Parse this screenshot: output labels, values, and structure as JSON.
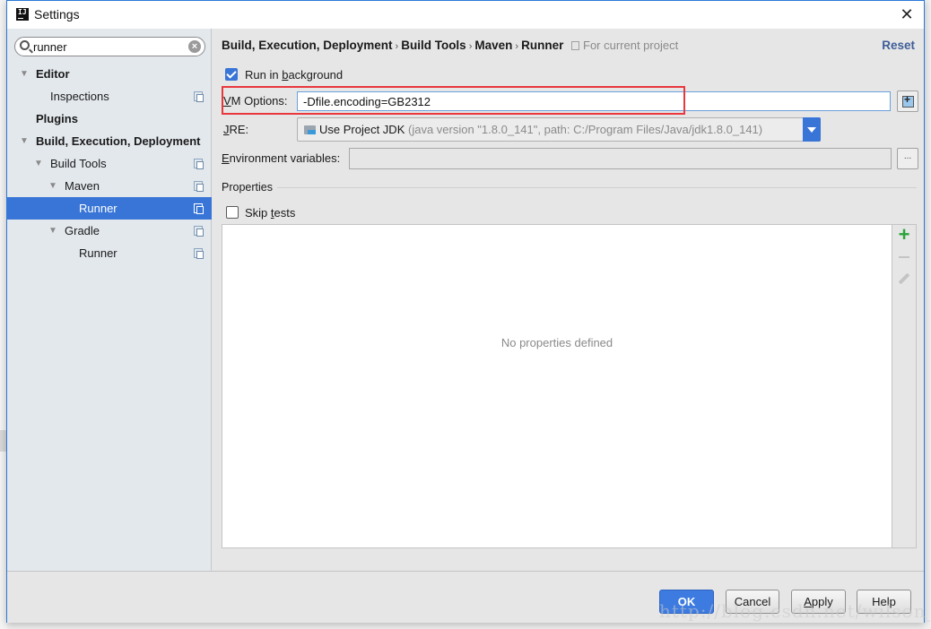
{
  "window": {
    "title": "Settings",
    "app_icon_text": "IJ",
    "close_glyph": "✕"
  },
  "sidebar": {
    "search": {
      "value": "runner",
      "placeholder": ""
    },
    "tree": [
      {
        "label": "Editor",
        "level": 0,
        "expanded": true,
        "bold": true,
        "has_copy_icon": false
      },
      {
        "label": "Inspections",
        "level": 1,
        "bold": false,
        "has_copy_icon": true
      },
      {
        "label": "Plugins",
        "level": 0,
        "bold": true,
        "has_copy_icon": false
      },
      {
        "label": "Build, Execution, Deployment",
        "level": 0,
        "expanded": true,
        "bold": true,
        "has_copy_icon": false
      },
      {
        "label": "Build Tools",
        "level": 1,
        "expanded": true,
        "bold": false,
        "has_copy_icon": true
      },
      {
        "label": "Maven",
        "level": 2,
        "expanded": true,
        "bold": false,
        "has_copy_icon": true
      },
      {
        "label": "Runner",
        "level": 3,
        "bold": false,
        "has_copy_icon": true,
        "selected": true
      },
      {
        "label": "Gradle",
        "level": 2,
        "expanded": true,
        "bold": false,
        "has_copy_icon": true
      },
      {
        "label": "Runner",
        "level": 3,
        "bold": false,
        "has_copy_icon": true
      }
    ]
  },
  "main": {
    "breadcrumb": [
      "Build, Execution, Deployment",
      "Build Tools",
      "Maven",
      "Runner"
    ],
    "breadcrumb_sep": "›",
    "scope_label": "For current project",
    "reset_label": "Reset",
    "run_in_background": {
      "label_pre": "Run in ",
      "label_mnemonic": "b",
      "label_post": "ackground",
      "checked": true
    },
    "vm_options": {
      "label_mnemonic": "V",
      "label_post": "M Options:",
      "value": "-Dfile.encoding=GB2312"
    },
    "jre": {
      "label_mnemonic": "J",
      "label_post": "RE:",
      "selected": "Use Project JDK",
      "detail": "(java version \"1.8.0_141\", path: C:/Program Files/Java/jdk1.8.0_141)"
    },
    "env_vars": {
      "label_mnemonic": "E",
      "label_post": "nvironment variables:",
      "value": "",
      "browse_label": "..."
    },
    "properties": {
      "section_title": "Properties",
      "skip_tests": {
        "label_pre": "Skip ",
        "label_mnemonic": "t",
        "label_post": "ests",
        "checked": false
      },
      "empty_text": "No properties defined",
      "add_glyph": "+"
    }
  },
  "footer": {
    "ok": "OK",
    "cancel": "Cancel",
    "apply_mnemonic": "A",
    "apply_post": "pply",
    "help": "Help"
  },
  "watermark": "http://blog.csdn.net/wilson_m",
  "colors": {
    "accent": "#3875d7",
    "highlight_box": "#e8383d",
    "reset_link": "#3f5e98",
    "add_green": "#2aa43a"
  }
}
